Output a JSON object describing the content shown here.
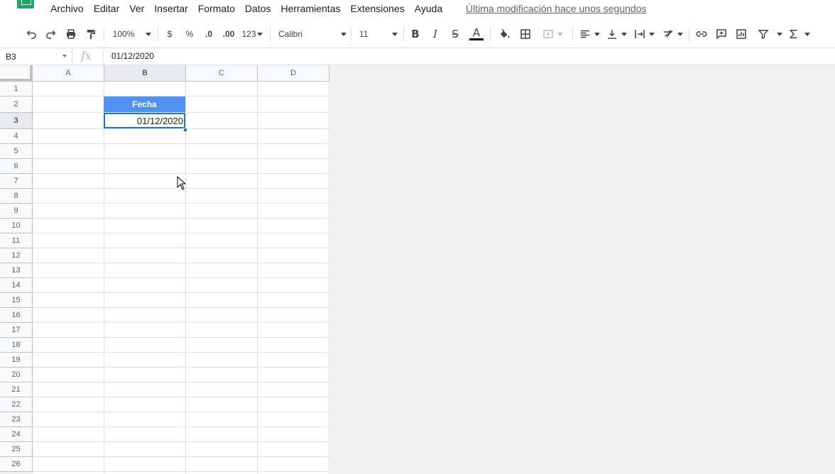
{
  "menu": {
    "items": [
      "Archivo",
      "Editar",
      "Ver",
      "Insertar",
      "Formato",
      "Datos",
      "Herramientas",
      "Extensiones",
      "Ayuda"
    ],
    "last_edit": "Última modificación hace unos segundos"
  },
  "toolbar": {
    "zoom": "100%",
    "currency": "$",
    "percent": "%",
    "decrease_decimal": ".0",
    "increase_decimal": ".00",
    "more_formats": "123",
    "font": "Calibri",
    "font_size": "11",
    "bold": "B",
    "italic": "I",
    "strike": "S",
    "text_color": "A"
  },
  "formula_bar": {
    "name_box": "B3",
    "fx": "fx",
    "value": "01/12/2020"
  },
  "grid": {
    "columns": [
      "A",
      "B",
      "C",
      "D"
    ],
    "rows": [
      "1",
      "2",
      "3",
      "4",
      "5",
      "6",
      "7",
      "8",
      "9",
      "10",
      "11",
      "12",
      "13",
      "14",
      "15",
      "16",
      "17",
      "18",
      "19",
      "20",
      "21",
      "22",
      "23",
      "24",
      "25",
      "26"
    ],
    "cells": {
      "B2": "Fecha",
      "B3": "01/12/2020"
    }
  },
  "colors": {
    "header_fill": "#4f92f0",
    "selection": "#1a73e8",
    "logo": "#23a566"
  }
}
